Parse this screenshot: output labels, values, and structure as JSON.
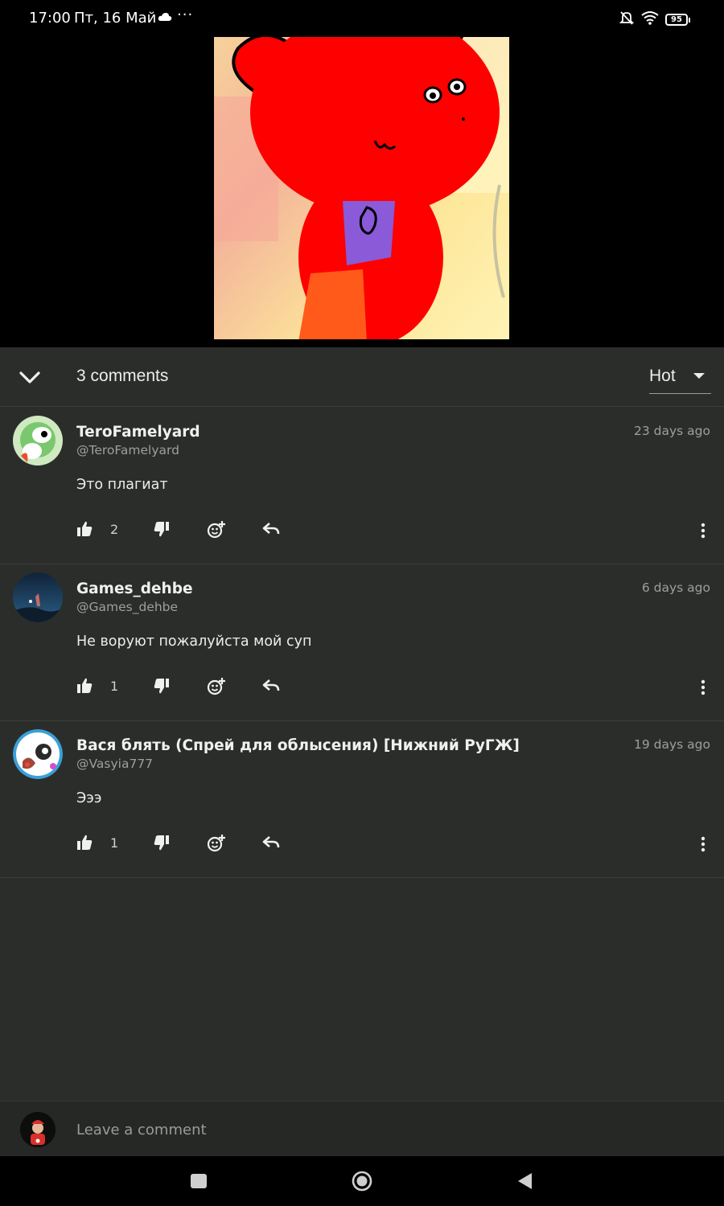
{
  "status_bar": {
    "time": "17:00",
    "date": "Пт, 16 Май",
    "battery": "95",
    "icons": [
      "cloud-icon",
      "more-dots-icon",
      "mute-bell-icon",
      "wifi-icon",
      "battery-icon"
    ]
  },
  "header": {
    "comments_count": "3 comments",
    "sort_value": "Hot"
  },
  "comments": [
    {
      "author": "TeroFamelyard",
      "handle": "@TeroFamelyard",
      "time": "23 days ago",
      "text": "Это плагиат",
      "likes": "2",
      "avatar_color": "#7ac86e"
    },
    {
      "author": "Games_dehbe",
      "handle": "@Games_dehbe",
      "time": "6 days ago",
      "text": "Не воруют пожалуйста мой суп",
      "likes": "1",
      "avatar_color": "#1a3b5c"
    },
    {
      "author": "Вася блять (Спрей для облысения) [Нижний РуГЖ]",
      "handle": "@Vasyia777",
      "time": "19 days ago",
      "text": "Эээ",
      "likes": "1",
      "avatar_color": "#3aa0d8"
    }
  ],
  "composer": {
    "placeholder": "Leave a comment"
  },
  "colors": {
    "panel_bg": "#2b2d2b",
    "artwork_red": "#ff0000"
  }
}
